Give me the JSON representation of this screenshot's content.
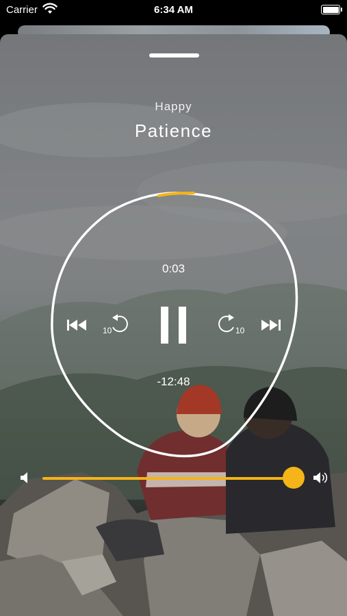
{
  "status_bar": {
    "carrier": "Carrier",
    "time": "6:34 AM"
  },
  "player": {
    "category": "Happy",
    "title": "Patience",
    "elapsed": "0:03",
    "remaining": "-12:48",
    "skip_back_seconds": "10",
    "skip_forward_seconds": "10",
    "progress_fraction": 0.004,
    "volume_fraction": 1.0,
    "state": "playing"
  },
  "colors": {
    "accent": "#f5b417",
    "foreground": "#ffffff"
  },
  "icons": {
    "previous": "previous-track-icon",
    "skip_back": "skip-back-10-icon",
    "pause": "pause-icon",
    "skip_forward": "skip-forward-10-icon",
    "next": "next-track-icon",
    "volume_low": "volume-low-icon",
    "volume_high": "volume-high-icon"
  }
}
